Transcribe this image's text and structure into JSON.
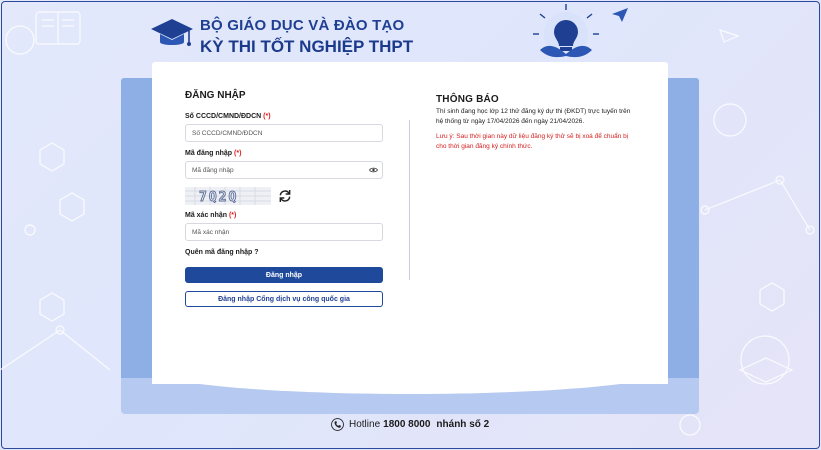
{
  "header": {
    "line1": "BỘ GIÁO DỤC VÀ ĐÀO TẠO",
    "line2": "KỲ THI TỐT NGHIỆP THPT"
  },
  "login": {
    "title": "ĐĂNG NHẬP",
    "id_label": "Số CCCD/CMND/ĐDCN",
    "id_placeholder": "Số CCCD/CMND/ĐDCN",
    "password_label": "Mã đăng nhập",
    "password_placeholder": "Mã đăng nhập",
    "required_mark": "(*)",
    "captcha_label": "Mã xác nhận",
    "captcha_placeholder": "Mã xác nhận",
    "captcha_text": "7Q2Q",
    "forgot": "Quên mã đăng nhập ?",
    "submit": "Đăng nhập",
    "national_portal": "Đăng nhập Cổng dịch vụ công quốc gia"
  },
  "notice": {
    "title": "THÔNG BÁO",
    "body": "Thí sinh đang học lớp 12 thử đăng ký dự thi (ĐKDT) trực tuyến trên hệ thống từ ngày 17/04/2026 đến ngày 21/04/2026.",
    "warning": "Lưu ý: Sau thời gian này dữ liệu đăng ký thử sẽ bị xoá để chuẩn bị cho thời gian đăng ký chính thức."
  },
  "footer": {
    "hotline_label": "Hotline",
    "hotline_number": "1800 8000",
    "hotline_ext": "nhánh số 2"
  },
  "icons": {
    "logo": "graduation-cap-icon",
    "eye": "eye-icon",
    "refresh": "refresh-icon",
    "phone": "phone-icon"
  },
  "colors": {
    "brand": "#1f3f93",
    "primary_button": "#1f4a9c",
    "required": "#e02020",
    "warning": "#d42020"
  }
}
